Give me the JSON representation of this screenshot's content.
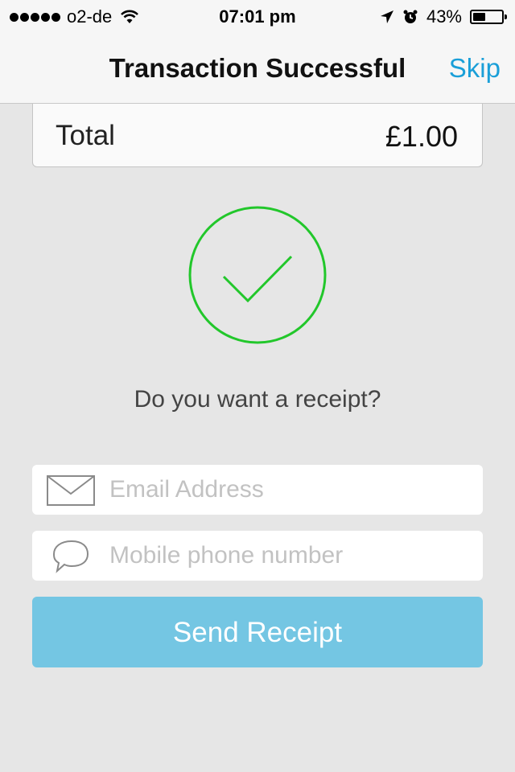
{
  "status_bar": {
    "carrier": "o2-de",
    "time": "07:01 pm",
    "battery_percent": "43%",
    "battery_level": 0.43,
    "icons": [
      "signal-dots-icon",
      "wifi-icon",
      "location-arrow-icon",
      "alarm-clock-icon",
      "battery-icon"
    ]
  },
  "nav": {
    "title": "Transaction Successful",
    "skip_label": "Skip"
  },
  "total": {
    "label": "Total",
    "value": "£1.00"
  },
  "success": {
    "icon": "checkmark-circle-icon",
    "color": "#22c72b"
  },
  "receipt": {
    "question": "Do you want a receipt?",
    "email_placeholder": "Email Address",
    "email_icon": "envelope-icon",
    "phone_placeholder": "Mobile phone number",
    "phone_icon": "speech-bubble-icon",
    "send_label": "Send Receipt"
  },
  "colors": {
    "accent": "#1a9fd8",
    "button": "#74c6e3",
    "background": "#e6e6e6"
  }
}
